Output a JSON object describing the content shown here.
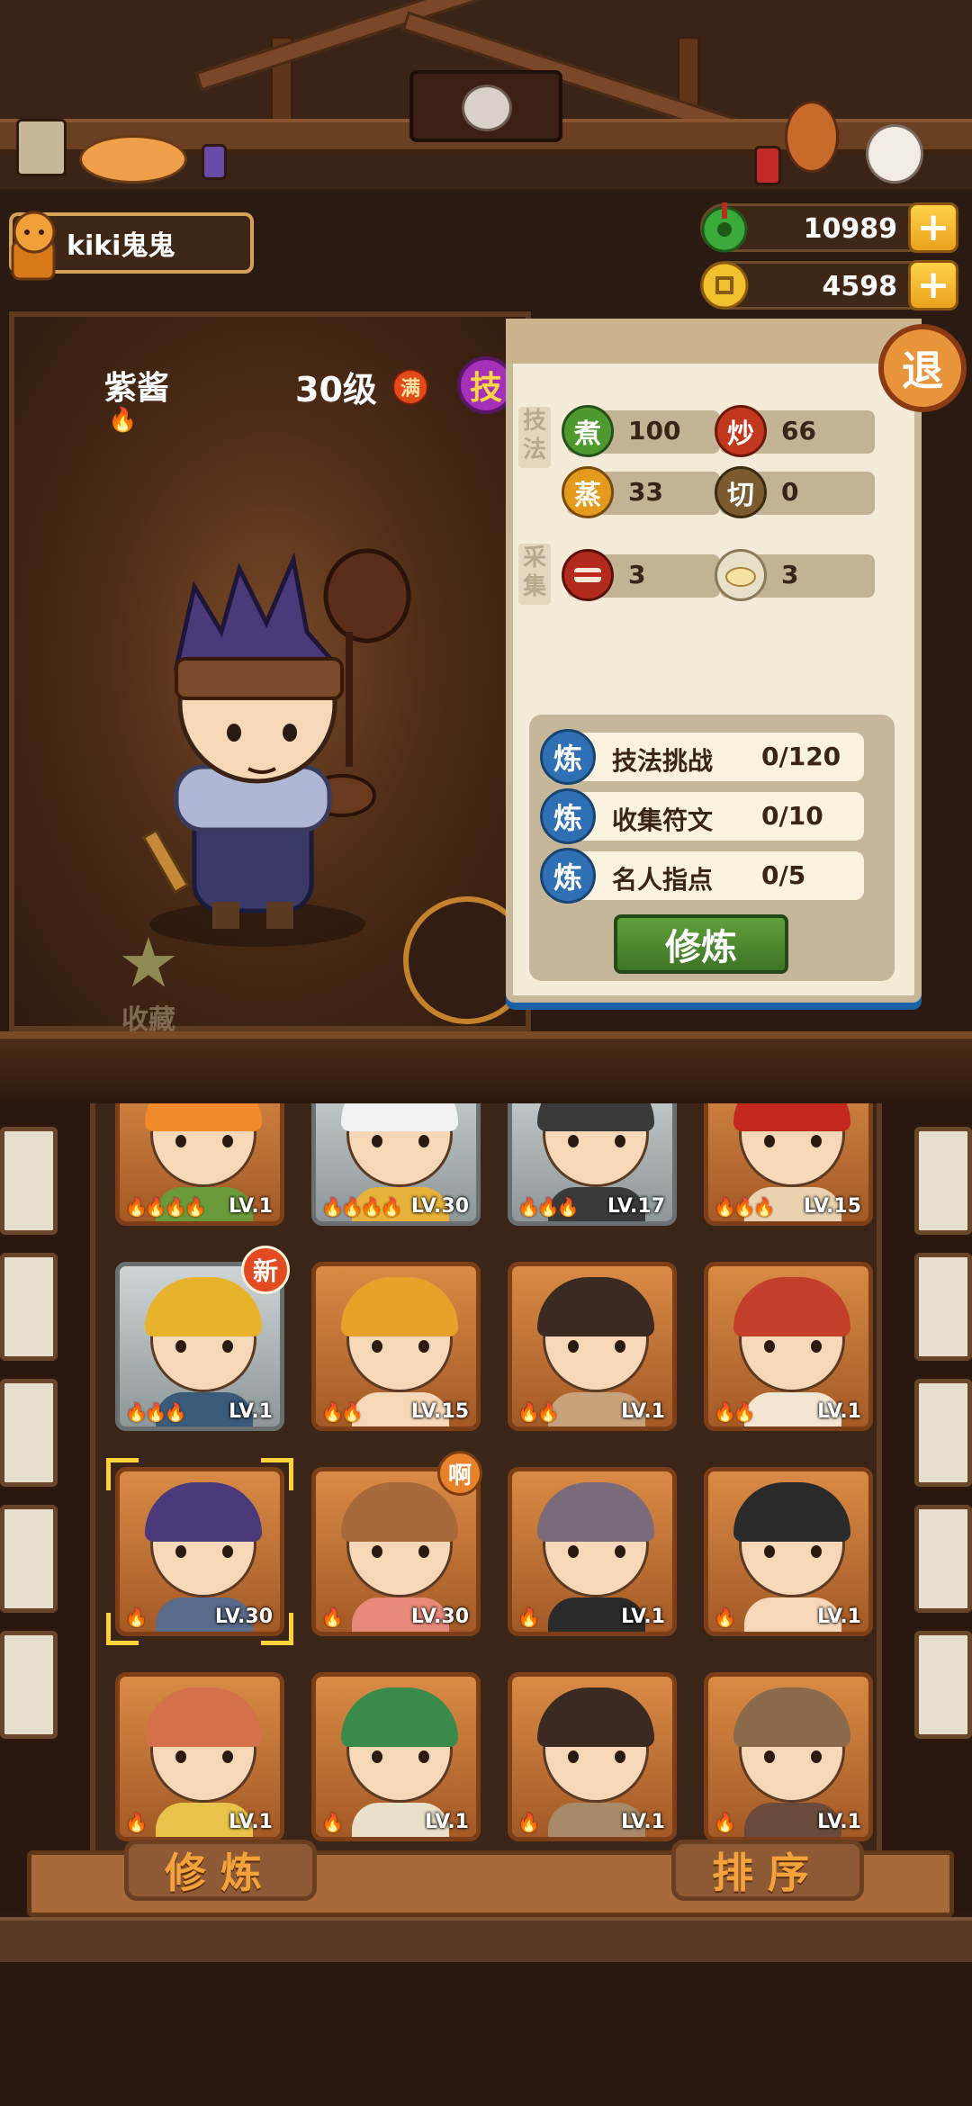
{
  "header": {
    "player_name": "kiki鬼鬼",
    "currencies": [
      {
        "name": "jade",
        "value": "10989",
        "icon": "green-jade-icon",
        "plus": "+"
      },
      {
        "name": "coin",
        "value": "4598",
        "icon": "gold-coin-icon",
        "plus": "+"
      }
    ],
    "exit_label": "退"
  },
  "character": {
    "name": "紫酱",
    "level": "30级",
    "full_badge": "满",
    "skill_badge": "技",
    "favorite_label": "收藏",
    "favorite_icon": "star-icon"
  },
  "stats": {
    "technique_label": "技法",
    "gather_label": "采集",
    "technique": [
      {
        "icon_char": "煮",
        "value": "100",
        "color": "#4f9a2f"
      },
      {
        "icon_char": "炒",
        "value": "66",
        "color": "#c2381e"
      },
      {
        "icon_char": "蒸",
        "value": "33",
        "color": "#e49a1c"
      },
      {
        "icon_char": "切",
        "value": "0",
        "color": "#7a5a2e"
      }
    ],
    "gather": [
      {
        "icon": "meat-icon",
        "value": "3"
      },
      {
        "icon": "bun-icon",
        "value": "3"
      }
    ]
  },
  "training": {
    "rows": [
      {
        "icon_char": "炼",
        "label": "技法挑战",
        "value": "0/120"
      },
      {
        "icon_char": "炼",
        "label": "收集符文",
        "value": "0/10"
      },
      {
        "icon_char": "炼",
        "label": "名人指点",
        "value": "0/5"
      }
    ],
    "button": "修炼"
  },
  "roster": [
    {
      "lv": "LV.1",
      "flames": "🔥🔥🔥🔥",
      "style": "gold",
      "hair": "#f08a2a",
      "body": "#6a9a3a",
      "badge": ""
    },
    {
      "lv": "LV.30",
      "flames": "🔥🔥🔥🔥",
      "style": "silver",
      "hair": "#f2f2f2",
      "body": "#e8b23a",
      "badge": ""
    },
    {
      "lv": "LV.17",
      "flames": "🔥🔥🔥",
      "style": "silver",
      "hair": "#3a3a3a",
      "body": "#3a3a3a",
      "badge": ""
    },
    {
      "lv": "LV.15",
      "flames": "🔥🔥🔥",
      "style": "gold",
      "hair": "#c2281e",
      "body": "#e8d2b0",
      "badge": ""
    },
    {
      "lv": "LV.1",
      "flames": "🔥🔥🔥",
      "style": "silver",
      "hair": "#e8b22a",
      "body": "#3a5a7a",
      "badge": "新"
    },
    {
      "lv": "LV.15",
      "flames": "🔥🔥",
      "style": "gold",
      "hair": "#e8a22a",
      "body": "#f6d7b8",
      "badge": ""
    },
    {
      "lv": "LV.1",
      "flames": "🔥🔥",
      "style": "gold",
      "hair": "#3a2a22",
      "body": "#c8a27a",
      "badge": ""
    },
    {
      "lv": "LV.1",
      "flames": "🔥🔥",
      "style": "gold",
      "hair": "#c2402a",
      "body": "#f2e6d2",
      "badge": ""
    },
    {
      "lv": "LV.30",
      "flames": "🔥",
      "style": "gold",
      "hair": "#4a3a7a",
      "body": "#5a6a8a",
      "badge": "",
      "selected": true
    },
    {
      "lv": "LV.30",
      "flames": "🔥",
      "style": "gold",
      "hair": "#a86a3a",
      "body": "#e88a7a",
      "badge": "啊"
    },
    {
      "lv": "LV.1",
      "flames": "🔥",
      "style": "gold",
      "hair": "#7a6a7a",
      "body": "#2a2a2a",
      "badge": ""
    },
    {
      "lv": "LV.1",
      "flames": "🔥",
      "style": "gold",
      "hair": "#2a2a2a",
      "body": "#f6d7b8",
      "badge": ""
    },
    {
      "lv": "LV.1",
      "flames": "🔥",
      "style": "gold",
      "hair": "#d4704a",
      "body": "#e8c24a",
      "badge": ""
    },
    {
      "lv": "LV.1",
      "flames": "🔥",
      "style": "gold",
      "hair": "#3a8a4a",
      "body": "#e8e0c8",
      "badge": ""
    },
    {
      "lv": "LV.1",
      "flames": "🔥",
      "style": "gold",
      "hair": "#3a2a22",
      "body": "#a88a6a",
      "badge": ""
    },
    {
      "lv": "LV.1",
      "flames": "🔥",
      "style": "gold",
      "hair": "#8a6a4a",
      "body": "#6a4a3a",
      "badge": ""
    }
  ],
  "bottom": {
    "train_button": "修炼",
    "sort_button": "排序"
  }
}
